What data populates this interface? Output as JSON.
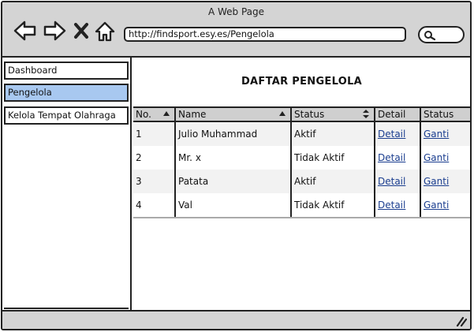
{
  "window": {
    "title": "A Web Page"
  },
  "browser": {
    "url": "http://findsport.esy.es/Pengelola",
    "icons": [
      "back-arrow-icon",
      "forward-arrow-icon",
      "close-icon",
      "home-icon",
      "search-icon"
    ]
  },
  "sidebar": {
    "items": [
      {
        "label": "Dashboard",
        "active": false
      },
      {
        "label": "Pengelola",
        "active": true
      },
      {
        "label": "Kelola Tempat Olahraga",
        "active": false
      }
    ]
  },
  "main": {
    "title": "DAFTAR PENGELOLA",
    "table": {
      "headers": [
        "No.",
        "Name",
        "Status",
        "Detail",
        "Status"
      ],
      "rows": [
        {
          "no": "1",
          "name": "Julio Muhammad",
          "status": "Aktif",
          "detail": "Detail",
          "action": "Ganti"
        },
        {
          "no": "2",
          "name": "Mr. x",
          "status": "Tidak Aktif",
          "detail": "Detail",
          "action": "Ganti"
        },
        {
          "no": "3",
          "name": "Patata",
          "status": "Aktif",
          "detail": "Detail",
          "action": "Ganti"
        },
        {
          "no": "4",
          "name": "Val",
          "status": "Tidak Aktif",
          "detail": "Detail",
          "action": "Ganti"
        }
      ]
    }
  },
  "colors": {
    "active_item": "#a8c8f0",
    "chrome": "#d4d4d4",
    "link": "#1a3d8f"
  }
}
